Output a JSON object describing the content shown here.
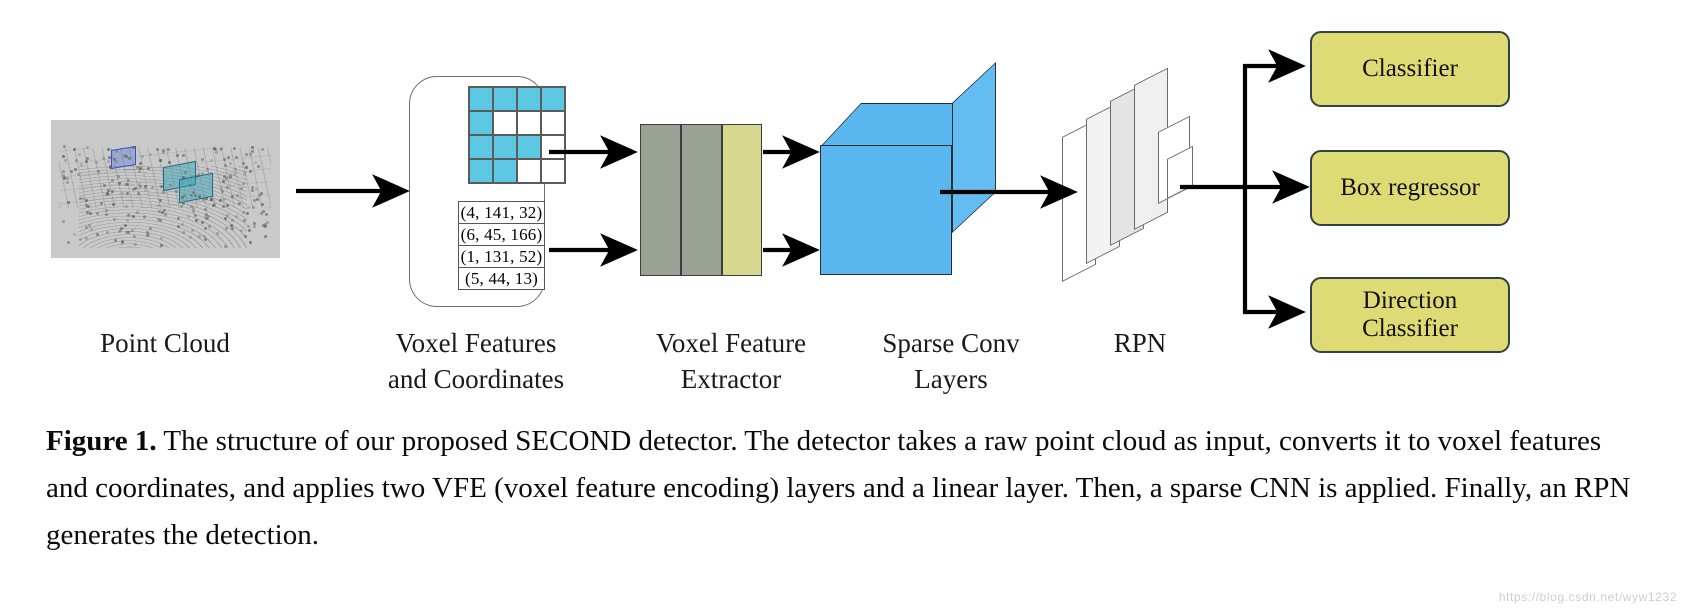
{
  "figure": {
    "caption_label": "Figure 1.",
    "caption_text": " The structure of our proposed SECOND detector. The detector takes a raw point cloud as input, converts it to voxel features and coordinates, and applies two VFE (voxel feature encoding) layers and a linear layer. Then, a sparse CNN is applied. Finally, an RPN generates the detection.",
    "watermark": "https://blog.csdn.net/wyw1232"
  },
  "stages": {
    "point_cloud": {
      "label": "Point Cloud",
      "icon": "point-cloud-icon"
    },
    "voxel_features": {
      "label": "Voxel Features\nand Coordinates"
    },
    "voxel_feature_extractor": {
      "label": "Voxel Feature\nExtractor"
    },
    "sparse_conv": {
      "label": "Sparse Conv\nLayers"
    },
    "rpn": {
      "label": "RPN"
    }
  },
  "voxel_grid": {
    "rows": [
      [
        1,
        1,
        1,
        1
      ],
      [
        1,
        0,
        0,
        0
      ],
      [
        1,
        1,
        1,
        0
      ],
      [
        1,
        1,
        0,
        0
      ]
    ],
    "on_color": "#5cc8e3",
    "off_color": "#ffffff",
    "border_color": "#5b5b5b"
  },
  "voxel_coordinates": [
    "(4, 141, 32)",
    "(6, 45, 166)",
    "(1, 131, 52)",
    "(5, 44, 13)"
  ],
  "vfe_layers": [
    {
      "name": "vfe-layer-1",
      "color": "#9aa296"
    },
    {
      "name": "vfe-layer-2",
      "color": "#9aa296"
    },
    {
      "name": "linear-layer",
      "color": "#d8d78f"
    }
  ],
  "sparse_conv_color": "#5bb7ef",
  "outputs": [
    {
      "name": "classifier",
      "label": "Classifier"
    },
    {
      "name": "box-regressor",
      "label": "Box regressor"
    },
    {
      "name": "direction-classifier",
      "label": "Direction\nClassifier"
    }
  ],
  "colors": {
    "output_box_fill": "#dfdb74",
    "output_box_border": "#2f4340",
    "arrow": "#000000",
    "point_cloud_background": "#c9c9c9"
  }
}
